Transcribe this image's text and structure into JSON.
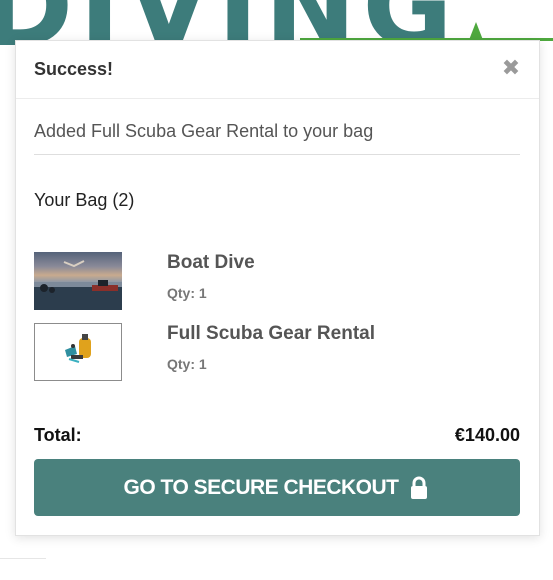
{
  "background": {
    "logo_text": "DIVING"
  },
  "popup": {
    "title": "Success!",
    "close_icon": "close-icon",
    "added_message": "Added Full Scuba Gear Rental to your bag",
    "bag_title": "Your Bag (2)",
    "items": [
      {
        "name": "Boat Dive",
        "qty": "Qty: 1",
        "thumb": "boat-dive-photo"
      },
      {
        "name": "Full Scuba Gear Rental",
        "qty": "Qty: 1",
        "thumb": "scuba-gear-photo"
      }
    ],
    "total_label": "Total:",
    "total_value": "€140.00",
    "checkout_label": "GO TO SECURE CHECKOUT",
    "checkout_icon": "lock-icon"
  },
  "colors": {
    "accent": "#4a817d",
    "brand_green": "#4ea83e",
    "logo_teal": "#3d7c7b"
  }
}
